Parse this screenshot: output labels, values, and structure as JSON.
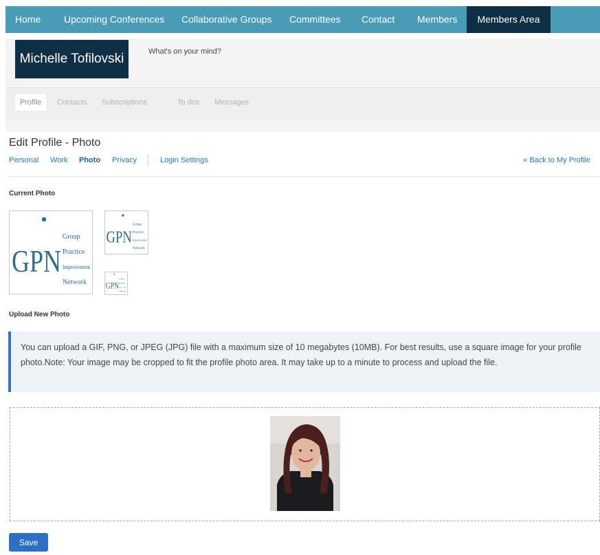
{
  "nav": {
    "items": [
      "Home",
      "Upcoming Conferences",
      "Collaborative Groups",
      "Committees",
      "Contact",
      "Members",
      "Members Area"
    ],
    "active": "Members Area"
  },
  "profile": {
    "name": "Michelle Tofilovski",
    "status_prompt": "What's on your mind?"
  },
  "profile_tabs": {
    "items": [
      "Profile",
      "Contacts",
      "Subscriptions",
      "To dos",
      "Messages"
    ],
    "active": "Profile"
  },
  "edit": {
    "title": "Edit Profile - Photo",
    "tabs": [
      "Personal",
      "Work",
      "Photo",
      "Privacy",
      "Login Settings"
    ],
    "active_tab": "Photo",
    "back_link": "« Back to My Profile"
  },
  "current_photo": {
    "label": "Current Photo",
    "logo": {
      "mark": "GPN",
      "words": [
        "Group",
        "Practice",
        "Improvement",
        "Network"
      ]
    }
  },
  "upload": {
    "label": "Upload New Photo",
    "info_text": "You can upload a GIF, PNG, or JPEG (JPG) file with a maximum size of 10 megabytes (10MB). For best results, use a square image for your profile photo.Note: Your image may be cropped to fit the profile photo area. It may take up to a minute to process and upload the file."
  },
  "save_label": "Save",
  "colors": {
    "nav_bg": "#4a9bb6",
    "nav_active": "#0f2f44",
    "link": "#2a74b8",
    "info_border": "#2d76c8",
    "info_bg": "#eef3f8",
    "save_bg": "#2b70c4",
    "logo_blue": "#2e6e8e"
  }
}
